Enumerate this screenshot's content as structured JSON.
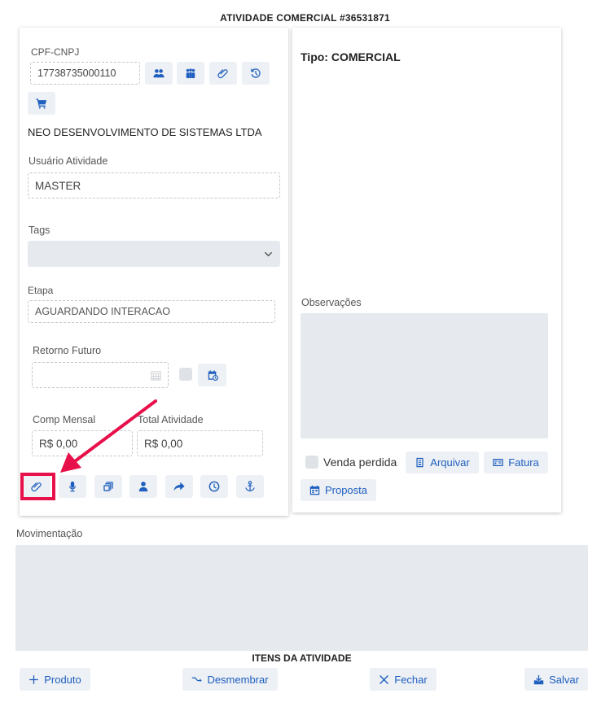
{
  "title": "ATIVIDADE COMERCIAL #36531871",
  "left": {
    "cpf_label": "CPF-CNPJ",
    "cpf_value": "17738735000110",
    "company": "NEO DESENVOLVIMENTO DE SISTEMAS LTDA",
    "user_label": "Usuário Atividade",
    "user_value": "MASTER",
    "tags_label": "Tags",
    "tags_value": "",
    "etapa_label": "Etapa",
    "etapa_value": "AGUARDANDO INTERACAO",
    "retorno_label": "Retorno Futuro",
    "retorno_value": "",
    "comp_label": "Comp Mensal",
    "comp_value": "R$ 0,00",
    "total_label": "Total Atividade",
    "total_value": "R$ 0,00"
  },
  "right": {
    "tipo": "Tipo: COMERCIAL",
    "obs_label": "Observações",
    "obs_value": "",
    "venda_perdida": "Venda perdida",
    "arquivar": "Arquivar",
    "fatura": "Fatura",
    "proposta": "Proposta"
  },
  "movimentacao_label": "Movimentação",
  "itens_label": "ITENS DA ATIVIDADE",
  "footer": {
    "produto": "Produto",
    "desmembrar": "Desmembrar",
    "fechar": "Fechar",
    "salvar": "Salvar"
  },
  "colors": {
    "accent": "#1e5fbf",
    "highlight": "#e8104a",
    "button_bg": "#edf0f4",
    "area_bg": "#e6e9ed"
  },
  "icons": {
    "cpf_row": [
      "users-icon",
      "group-icon",
      "paperclip-icon",
      "history-icon",
      "cart-icon"
    ],
    "action_row": [
      "paperclip-icon",
      "microphone-icon",
      "copy-icon",
      "person-icon",
      "share-icon",
      "clock-icon",
      "anchor-icon"
    ]
  }
}
